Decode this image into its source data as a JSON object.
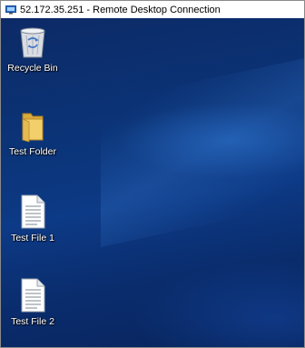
{
  "window": {
    "title": "52.172.35.251 - Remote Desktop Connection",
    "icon": "remote-desktop-icon"
  },
  "desktop": {
    "icons": [
      {
        "label": "Recycle Bin",
        "icon": "recycle-bin-icon"
      },
      {
        "label": "Test Folder",
        "icon": "folder-icon"
      },
      {
        "label": "Test File 1",
        "icon": "text-file-icon"
      },
      {
        "label": "Test File 2",
        "icon": "text-file-icon"
      }
    ]
  },
  "colors": {
    "desktop_background": "#0b3478",
    "label_text": "#ffffff",
    "folder": "#e8c15a"
  }
}
